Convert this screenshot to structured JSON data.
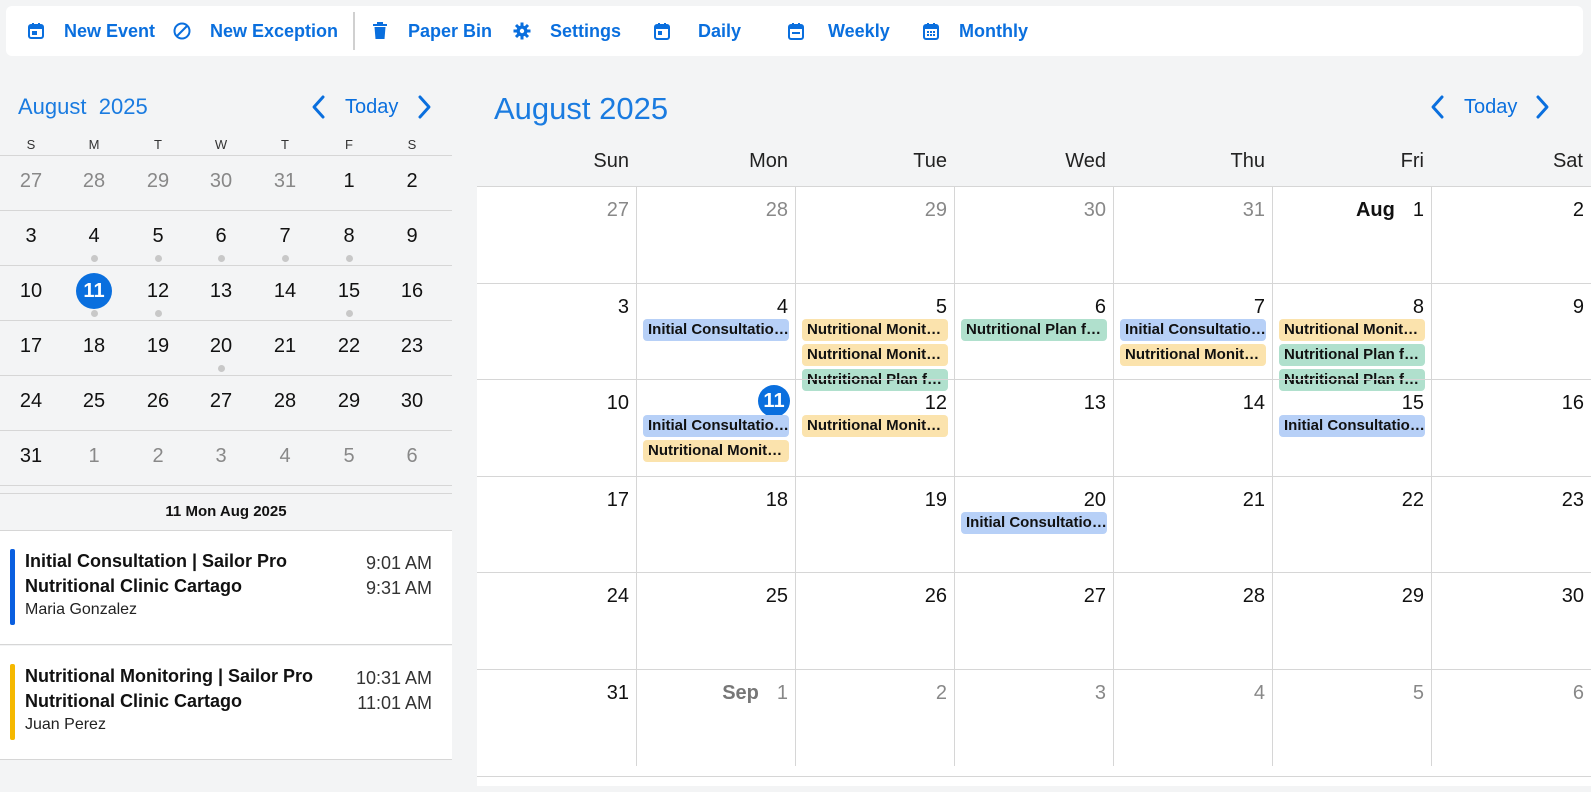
{
  "toolbar": {
    "new_event": "New Event",
    "new_exception": "New Exception",
    "paper_bin": "Paper Bin",
    "settings": "Settings",
    "daily": "Daily",
    "weekly": "Weekly",
    "monthly": "Monthly",
    "accent_color": "#0a6fde"
  },
  "mini_calendar": {
    "month": "August",
    "year": "2025",
    "today_label": "Today",
    "weekdays": [
      "S",
      "M",
      "T",
      "W",
      "T",
      "F",
      "S"
    ],
    "weeks": [
      [
        {
          "d": "27",
          "o": true
        },
        {
          "d": "28",
          "o": true
        },
        {
          "d": "29",
          "o": true
        },
        {
          "d": "30",
          "o": true
        },
        {
          "d": "31",
          "o": true
        },
        {
          "d": "1"
        },
        {
          "d": "2"
        }
      ],
      [
        {
          "d": "3"
        },
        {
          "d": "4",
          "dot": true
        },
        {
          "d": "5",
          "dot": true
        },
        {
          "d": "6",
          "dot": true
        },
        {
          "d": "7",
          "dot": true
        },
        {
          "d": "8",
          "dot": true
        },
        {
          "d": "9"
        }
      ],
      [
        {
          "d": "10"
        },
        {
          "d": "11",
          "today": true,
          "dot": true
        },
        {
          "d": "12",
          "dot": true
        },
        {
          "d": "13"
        },
        {
          "d": "14"
        },
        {
          "d": "15",
          "dot": true
        },
        {
          "d": "16"
        }
      ],
      [
        {
          "d": "17"
        },
        {
          "d": "18"
        },
        {
          "d": "19"
        },
        {
          "d": "20",
          "dot": true
        },
        {
          "d": "21"
        },
        {
          "d": "22"
        },
        {
          "d": "23"
        }
      ],
      [
        {
          "d": "24"
        },
        {
          "d": "25"
        },
        {
          "d": "26"
        },
        {
          "d": "27"
        },
        {
          "d": "28"
        },
        {
          "d": "29"
        },
        {
          "d": "30"
        }
      ],
      [
        {
          "d": "31"
        },
        {
          "d": "1",
          "o": true
        },
        {
          "d": "2",
          "o": true
        },
        {
          "d": "3",
          "o": true
        },
        {
          "d": "4",
          "o": true
        },
        {
          "d": "5",
          "o": true
        },
        {
          "d": "6",
          "o": true
        }
      ]
    ]
  },
  "agenda": {
    "date_heading": "11 Mon Aug 2025",
    "items": [
      {
        "title": "Initial Consultation | Sailor Pro Nutritional Clinic Cartago",
        "person": "Maria Gonzalez",
        "start": "9:01 AM",
        "end": "9:31 AM",
        "color": "#0a5fe0"
      },
      {
        "title": "Nutritional Monitoring | Sailor Pro Nutritional Clinic Cartago",
        "person": "Juan Perez",
        "start": "10:31 AM",
        "end": "11:01 AM",
        "color": "#f5b800"
      }
    ]
  },
  "main_calendar": {
    "title": "August 2025",
    "today_label": "Today",
    "weekdays": [
      "Sun",
      "Mon",
      "Tue",
      "Wed",
      "Thu",
      "Fri",
      "Sat"
    ],
    "weeks": [
      [
        {
          "d": "27",
          "o": true
        },
        {
          "d": "28",
          "o": true
        },
        {
          "d": "29",
          "o": true
        },
        {
          "d": "30",
          "o": true
        },
        {
          "d": "31",
          "o": true
        },
        {
          "d": "1",
          "month": "Aug"
        },
        {
          "d": "2"
        }
      ],
      [
        {
          "d": "3"
        },
        {
          "d": "4",
          "events": [
            {
              "t": "Initial Consultation | Sailor Pro Nutritional Clinic Cartago",
              "c": "blue"
            }
          ]
        },
        {
          "d": "5",
          "events": [
            {
              "t": "Nutritional Monitoring | Sailor Pro Nutritional Clinic Cartago",
              "c": "yellow"
            },
            {
              "t": "Nutritional Monitoring | Sailor Pro Nutritional Clinic Cartago",
              "c": "yellow"
            },
            {
              "t": "Nutritional Plan follow-up | Sailor Pro Nutritional Clinic Cartago",
              "c": "green"
            }
          ]
        },
        {
          "d": "6",
          "events": [
            {
              "t": "Nutritional Plan follow-up | Sailor Pro Nutritional Clinic Cartago",
              "c": "green"
            }
          ]
        },
        {
          "d": "7",
          "events": [
            {
              "t": "Initial Consultation | Sailor Pro Nutritional Clinic Cartago",
              "c": "blue"
            },
            {
              "t": "Nutritional Monitoring | Sailor Pro Nutritional Clinic Cartago",
              "c": "yellow"
            }
          ]
        },
        {
          "d": "8",
          "events": [
            {
              "t": "Nutritional Monitoring | Sailor Pro Nutritional Clinic Cartago",
              "c": "yellow"
            },
            {
              "t": "Nutritional Plan follow-up | Sailor Pro Nutritional Clinic Cartago",
              "c": "green"
            },
            {
              "t": "Nutritional Plan follow-up | Sailor Pro Nutritional Clinic Cartago",
              "c": "green"
            }
          ]
        },
        {
          "d": "9"
        }
      ],
      [
        {
          "d": "10"
        },
        {
          "d": "11",
          "today": true,
          "events": [
            {
              "t": "Initial Consultation | Sailor Pro Nutritional Clinic Cartago",
              "c": "blue"
            },
            {
              "t": "Nutritional Monitoring | Sailor Pro Nutritional Clinic Cartago",
              "c": "yellow"
            }
          ]
        },
        {
          "d": "12",
          "events": [
            {
              "t": "Nutritional Monitoring | Sailor Pro Nutritional Clinic Cartago",
              "c": "yellow"
            }
          ]
        },
        {
          "d": "13"
        },
        {
          "d": "14"
        },
        {
          "d": "15",
          "events": [
            {
              "t": "Initial Consultation | Sailor Pro Nutritional Clinic Cartago",
              "c": "blue"
            }
          ]
        },
        {
          "d": "16"
        }
      ],
      [
        {
          "d": "17"
        },
        {
          "d": "18"
        },
        {
          "d": "19"
        },
        {
          "d": "20",
          "events": [
            {
              "t": "Initial Consultation | Sailor Pro Nutritional Clinic Cartago",
              "c": "blue"
            }
          ]
        },
        {
          "d": "21"
        },
        {
          "d": "22"
        },
        {
          "d": "23"
        }
      ],
      [
        {
          "d": "24"
        },
        {
          "d": "25"
        },
        {
          "d": "26"
        },
        {
          "d": "27"
        },
        {
          "d": "28"
        },
        {
          "d": "29"
        },
        {
          "d": "30"
        }
      ],
      [
        {
          "d": "31"
        },
        {
          "d": "1",
          "o": true,
          "month": "Sep"
        },
        {
          "d": "2",
          "o": true
        },
        {
          "d": "3",
          "o": true
        },
        {
          "d": "4",
          "o": true
        },
        {
          "d": "5",
          "o": true
        },
        {
          "d": "6",
          "o": true
        }
      ]
    ]
  }
}
